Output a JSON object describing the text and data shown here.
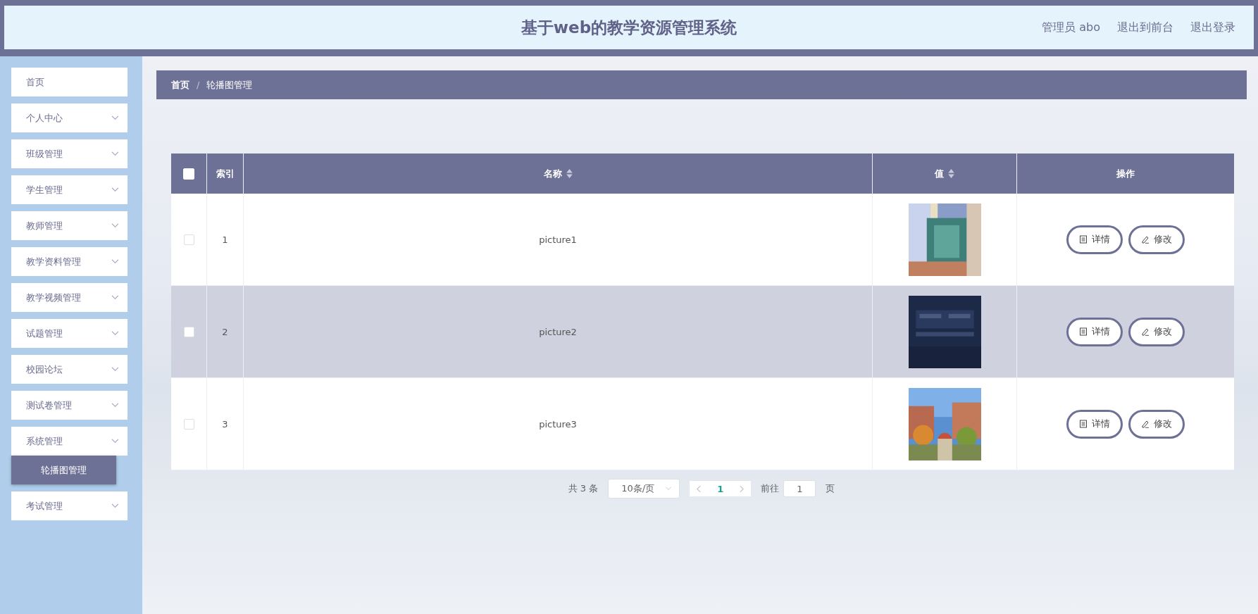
{
  "header": {
    "title": "基于web的教学资源管理系统",
    "user": "管理员 abo",
    "links": [
      "退出到前台",
      "退出登录"
    ]
  },
  "sidebar": {
    "items": [
      {
        "label": "首页",
        "has_arrow": false
      },
      {
        "label": "个人中心",
        "has_arrow": true
      },
      {
        "label": "班级管理",
        "has_arrow": true
      },
      {
        "label": "学生管理",
        "has_arrow": true
      },
      {
        "label": "教师管理",
        "has_arrow": true
      },
      {
        "label": "教学资料管理",
        "has_arrow": true
      },
      {
        "label": "教学视频管理",
        "has_arrow": true
      },
      {
        "label": "试题管理",
        "has_arrow": true
      },
      {
        "label": "校园论坛",
        "has_arrow": true
      },
      {
        "label": "测试卷管理",
        "has_arrow": true
      },
      {
        "label": "系统管理",
        "has_arrow": true,
        "expanded": true,
        "children": [
          {
            "label": "轮播图管理",
            "selected": true
          }
        ]
      },
      {
        "label": "考试管理",
        "has_arrow": true
      }
    ]
  },
  "breadcrumb": {
    "separator": "/",
    "items": [
      "首页",
      "轮播图管理"
    ]
  },
  "table": {
    "select_all": {
      "checked": false
    },
    "columns": [
      {
        "label": "索引"
      },
      {
        "label": "名称",
        "sortable": true
      },
      {
        "label": "值",
        "sortable": true
      },
      {
        "label": "操作"
      }
    ],
    "rows": [
      {
        "checked": false,
        "highlighted": false,
        "index": "1",
        "name": "picture1",
        "image": {
          "kind": "picture"
        },
        "actions": [
          "详情",
          "修改"
        ]
      },
      {
        "checked": false,
        "highlighted": true,
        "index": "2",
        "name": "picture2",
        "image": {
          "kind": "picture"
        },
        "actions": [
          "详情",
          "修改"
        ]
      },
      {
        "checked": false,
        "highlighted": false,
        "index": "3",
        "name": "picture3",
        "image": {
          "kind": "picture"
        },
        "actions": [
          "详情",
          "修改"
        ]
      }
    ]
  },
  "pagination": {
    "total": "共 3 条",
    "page_size": "10条/页",
    "pages": [
      {
        "label": "1",
        "selected": true
      }
    ],
    "goto_label": "前往",
    "goto_value": "1",
    "goto_suffix": "页"
  }
}
